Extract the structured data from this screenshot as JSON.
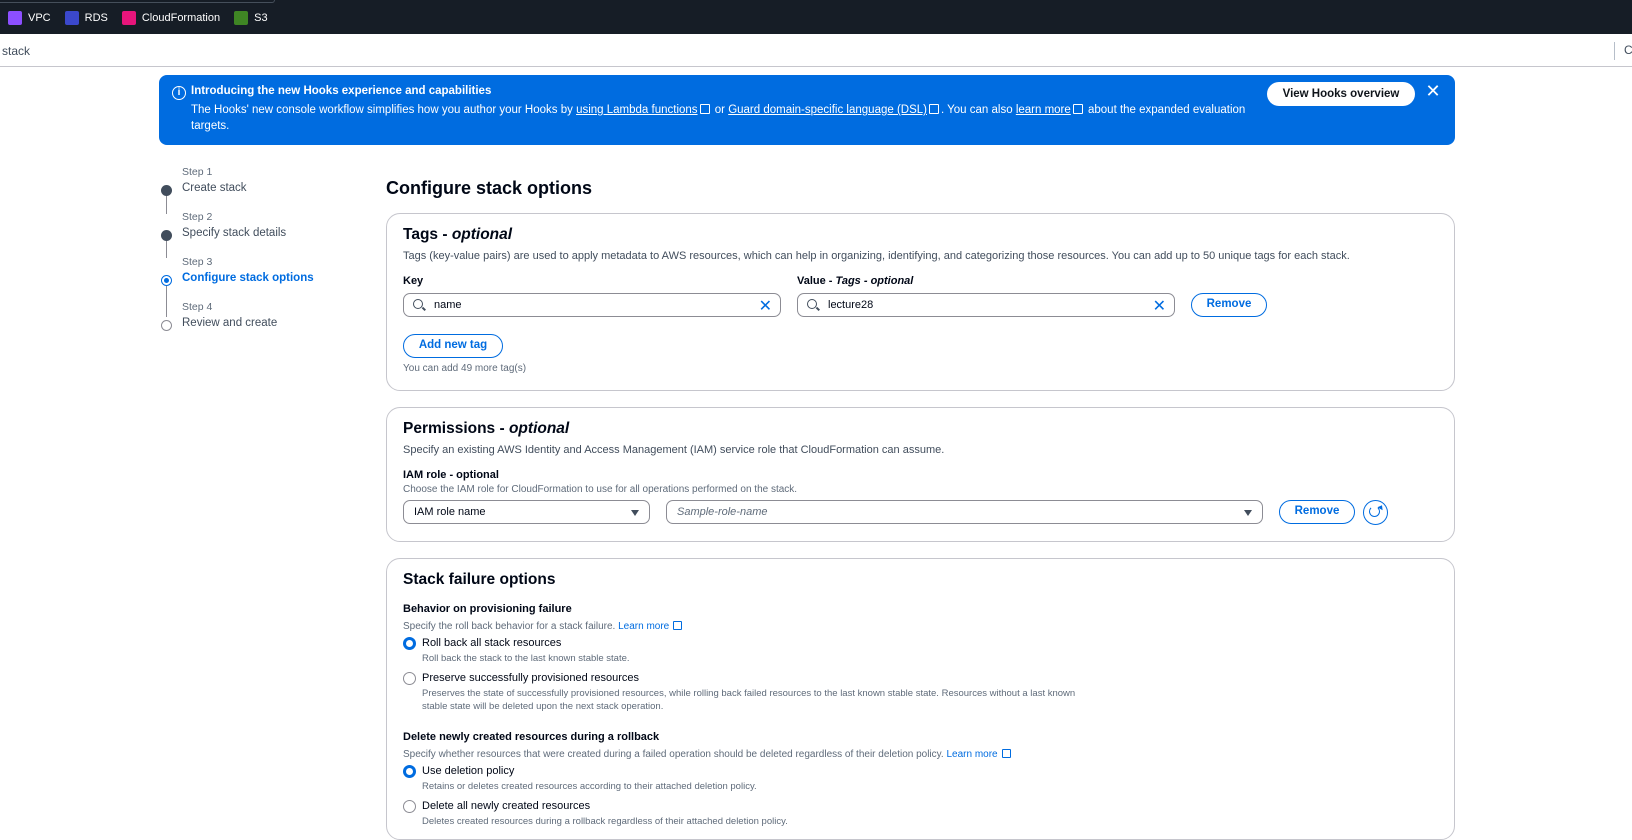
{
  "favorites": [
    {
      "label": "VPC",
      "color": "#8c4fff"
    },
    {
      "label": "RDS",
      "color": "#3b48cc"
    },
    {
      "label": "CloudFormation",
      "color": "#e7157b"
    },
    {
      "label": "S3",
      "color": "#3f8624"
    }
  ],
  "breadcrumb": "stack",
  "banner": {
    "title": "Introducing the new Hooks experience and capabilities",
    "text_1": "The Hooks' new console workflow simplifies how you author your Hooks by",
    "link_1": "using Lambda functions",
    "text_2": "or",
    "link_2": "Guard domain-specific language (DSL)",
    "text_3": ". You can also",
    "link_3": "learn more",
    "text_4": "about the expanded evaluation targets.",
    "button": "View Hooks overview"
  },
  "steps": [
    {
      "label": "Step 1",
      "name": "Create stack",
      "state": "done"
    },
    {
      "label": "Step 2",
      "name": "Specify stack details",
      "state": "done"
    },
    {
      "label": "Step 3",
      "name": "Configure stack options",
      "state": "active"
    },
    {
      "label": "Step 4",
      "name": "Review and create",
      "state": "pending"
    }
  ],
  "page_title": "Configure stack options",
  "tags": {
    "title": "Tags -",
    "title_opt": "optional",
    "description": "Tags (key-value pairs) are used to apply metadata to AWS resources, which can help in organizing, identifying, and categorizing those resources. You can add up to 50 unique tags for each stack.",
    "key_label": "Key",
    "value_label": "Value -",
    "value_label_opt": "Tags - optional",
    "key_value": "name",
    "value_value": "lecture28",
    "remove": "Remove",
    "add": "Add new tag",
    "limit_hint": "You can add 49 more tag(s)"
  },
  "permissions": {
    "title": "Permissions -",
    "title_opt": "optional",
    "description": "Specify an existing AWS Identity and Access Management (IAM) service role that CloudFormation can assume.",
    "role_label": "IAM role - optional",
    "role_hint": "Choose the IAM role for CloudFormation to use for all operations performed on the stack.",
    "role_type": "IAM role name",
    "role_placeholder": "Sample-role-name",
    "remove": "Remove"
  },
  "failure": {
    "title": "Stack failure options",
    "behavior_label": "Behavior on provisioning failure",
    "behavior_hint": "Specify the roll back behavior for a stack failure.",
    "learn_more": "Learn more",
    "options": [
      {
        "title": "Roll back all stack resources",
        "desc": "Roll back the stack to the last known stable state.",
        "selected": true
      },
      {
        "title": "Preserve successfully provisioned resources",
        "desc": "Preserves the state of successfully provisioned resources, while rolling back failed resources to the last known stable state. Resources without a last known stable state will be deleted upon the next stack operation.",
        "selected": false
      }
    ],
    "delete_label": "Delete newly created resources during a rollback",
    "delete_hint": "Specify whether resources that were created during a failed operation should be deleted regardless of their deletion policy.",
    "delete_options": [
      {
        "title": "Use deletion policy",
        "desc": "Retains or deletes created resources according to their attached deletion policy.",
        "selected": true
      },
      {
        "title": "Delete all newly created resources",
        "desc": "Deletes created resources during a rollback regardless of their attached deletion policy.",
        "selected": false
      }
    ]
  }
}
